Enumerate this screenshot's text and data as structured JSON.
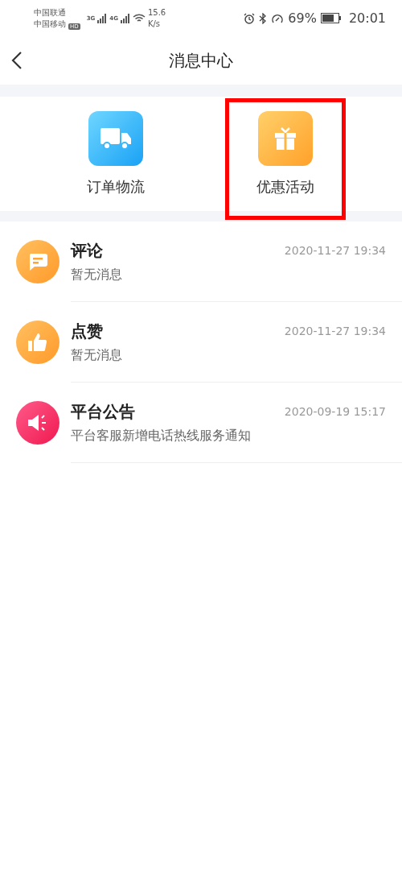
{
  "status_bar": {
    "carriers": [
      "中国联通",
      "中国移动"
    ],
    "hd_badge": "HD",
    "network_1": "3G",
    "network_2": "4G",
    "speed": "15.6",
    "speed_unit": "K/s",
    "battery": "69%",
    "time": "20:01"
  },
  "header": {
    "title": "消息中心"
  },
  "shortcuts": [
    {
      "kind": "truck",
      "label": "订单物流",
      "highlighted": false
    },
    {
      "kind": "gift",
      "label": "优惠活动",
      "highlighted": true
    }
  ],
  "messages": [
    {
      "kind": "comment",
      "title": "评论",
      "time": "2020-11-27 19:34",
      "preview": "暂无消息"
    },
    {
      "kind": "like",
      "title": "点赞",
      "time": "2020-11-27 19:34",
      "preview": "暂无消息"
    },
    {
      "kind": "announcement",
      "title": "平台公告",
      "time": "2020-09-19 15:17",
      "preview": "平台客服新增电话热线服务通知"
    }
  ]
}
